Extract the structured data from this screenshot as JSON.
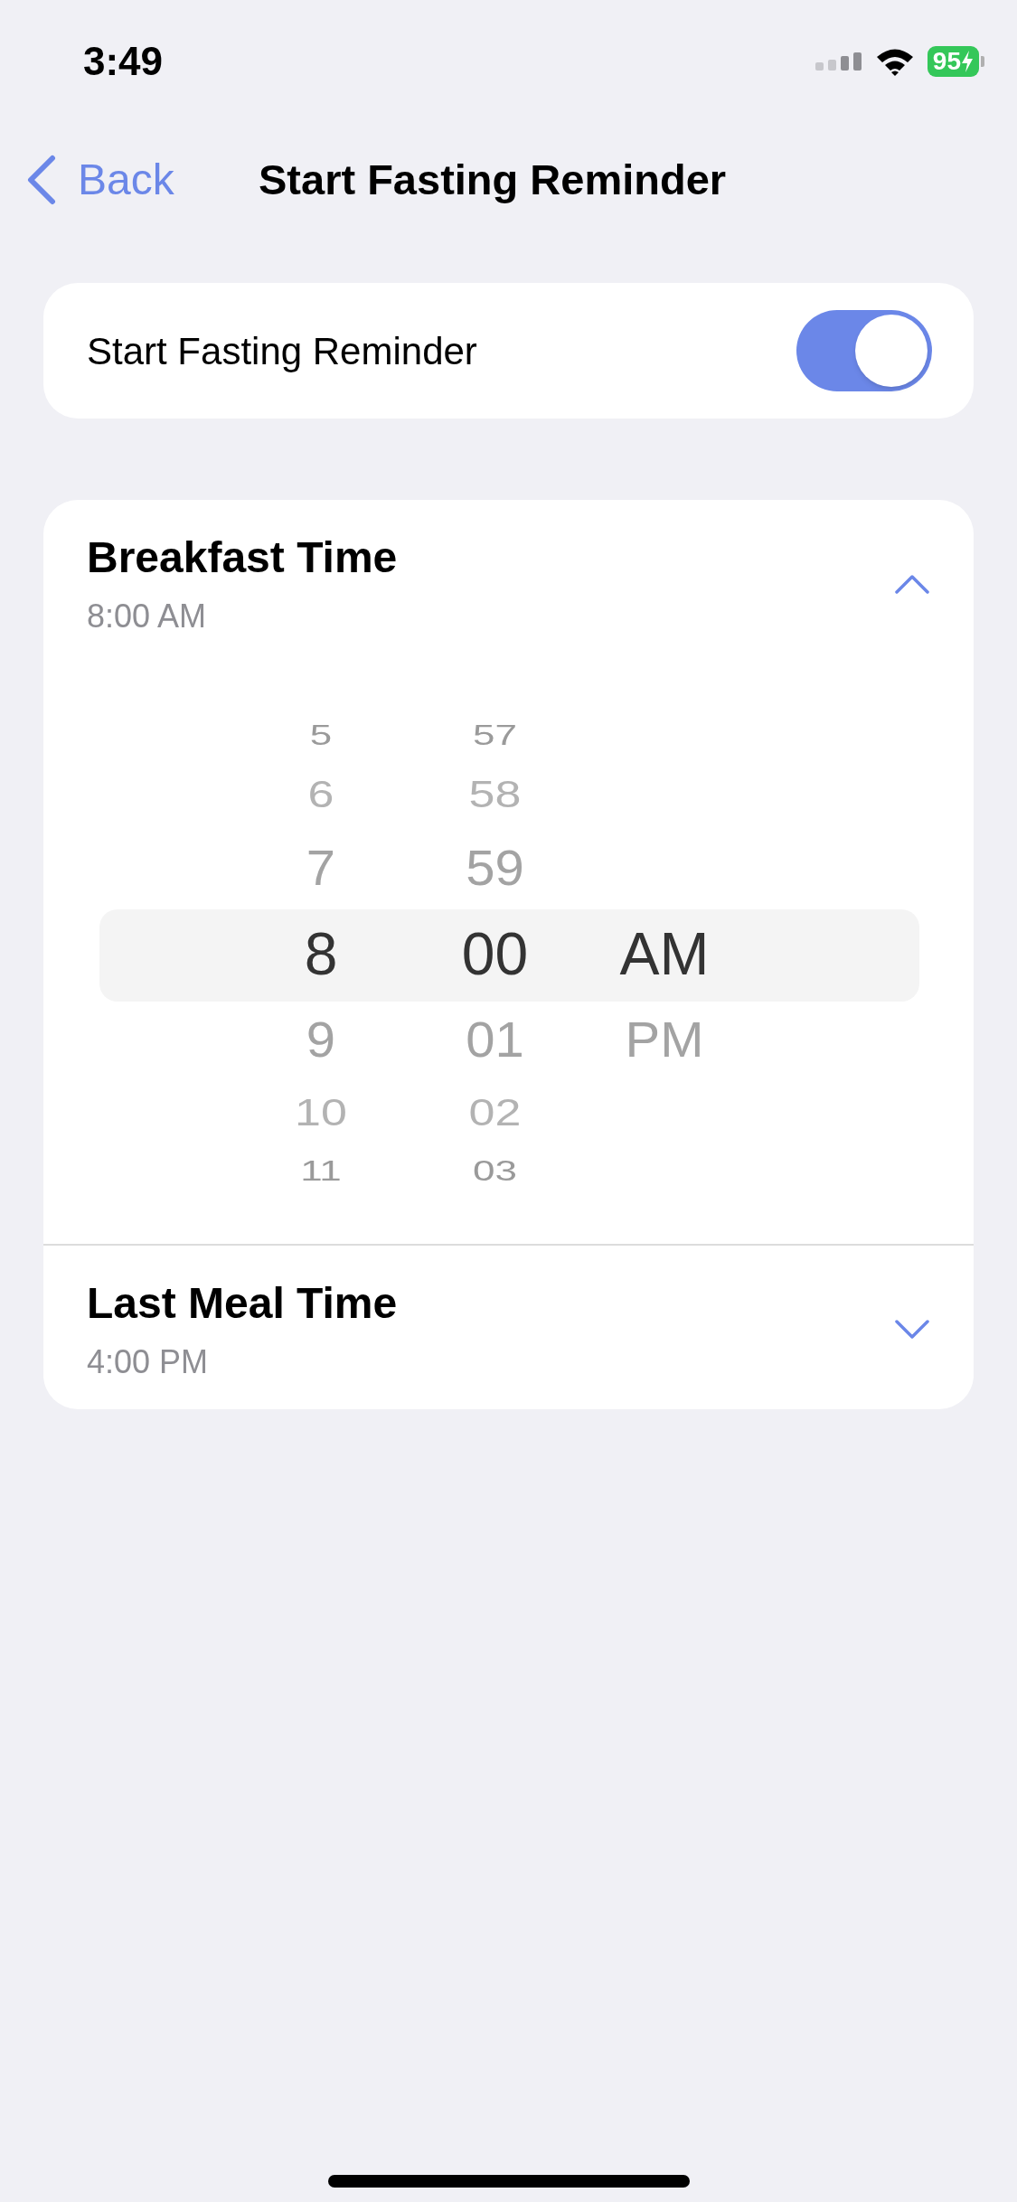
{
  "status_bar": {
    "time": "3:49",
    "battery": "95"
  },
  "nav": {
    "back": "Back",
    "title": "Start Fasting Reminder"
  },
  "reminder": {
    "label": "Start Fasting Reminder",
    "on": true
  },
  "sections": [
    {
      "title": "Breakfast Time",
      "value": "8:00 AM",
      "expanded": true,
      "picker": {
        "columns": [
          {
            "items": [
              {
                "label": "5",
                "selected": false
              },
              {
                "label": "6",
                "selected": false
              },
              {
                "label": "7",
                "selected": false
              },
              {
                "label": "8",
                "selected": true
              },
              {
                "label": "9",
                "selected": false
              },
              {
                "label": "10",
                "selected": false
              },
              {
                "label": "11",
                "selected": false
              }
            ]
          },
          {
            "items": [
              {
                "label": "57",
                "selected": false
              },
              {
                "label": "58",
                "selected": false
              },
              {
                "label": "59",
                "selected": false
              },
              {
                "label": "00",
                "selected": true
              },
              {
                "label": "01",
                "selected": false
              },
              {
                "label": "02",
                "selected": false
              },
              {
                "label": "03",
                "selected": false
              }
            ]
          },
          {
            "items": [
              {
                "label": "AM",
                "selected": true
              },
              {
                "label": "PM",
                "selected": false
              }
            ]
          }
        ]
      }
    },
    {
      "title": "Last Meal Time",
      "value": "4:00 PM",
      "expanded": false
    }
  ]
}
